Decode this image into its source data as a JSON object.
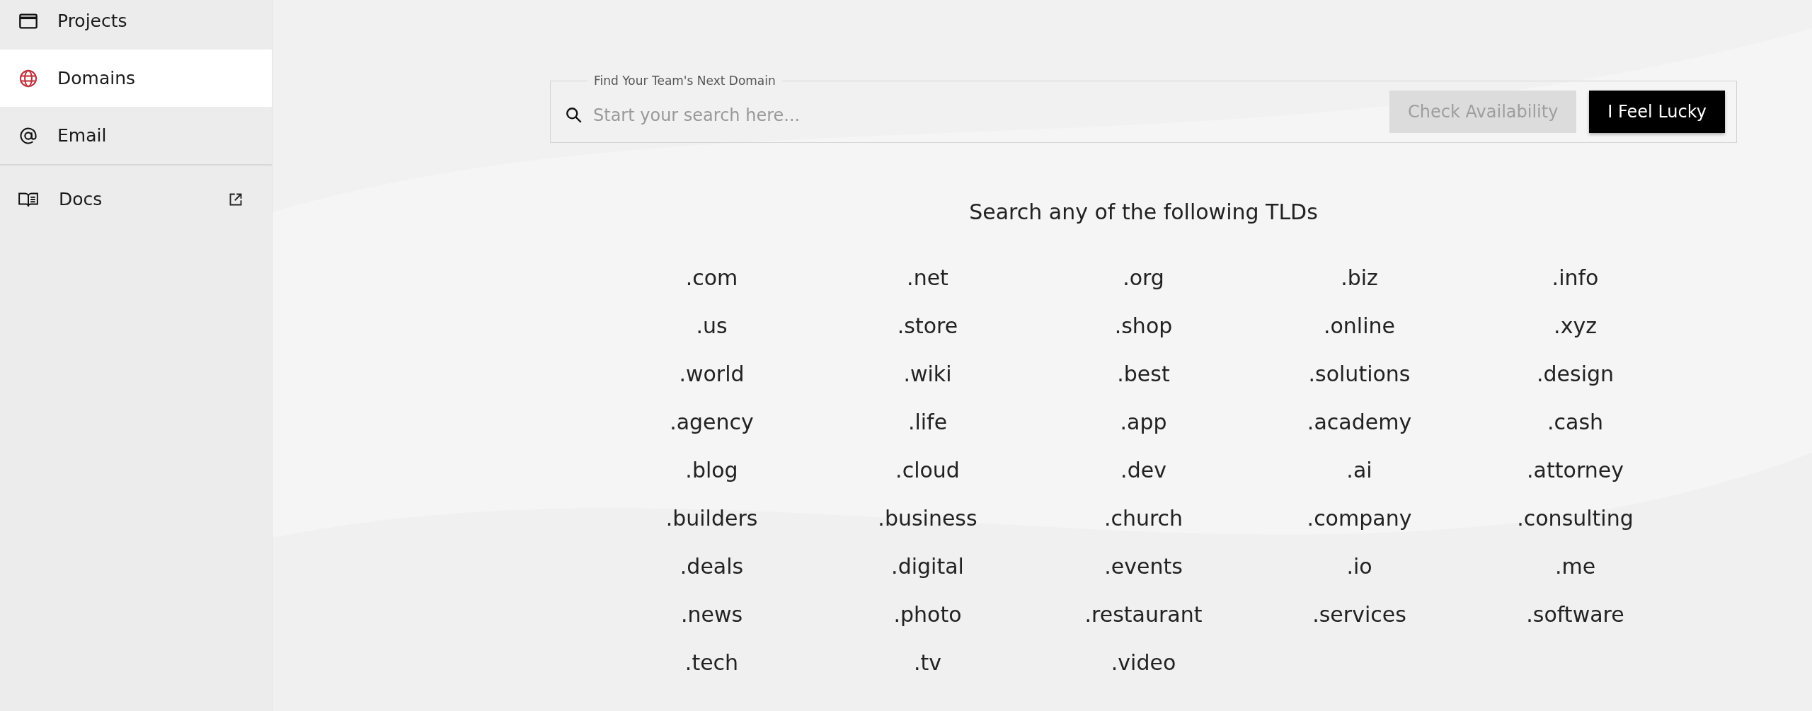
{
  "sidebar": {
    "items": [
      {
        "label": "Projects",
        "kind": "window",
        "selected": false,
        "external": false
      },
      {
        "label": "Domains",
        "kind": "globe",
        "selected": true,
        "external": false
      },
      {
        "label": "Email",
        "kind": "at",
        "selected": false,
        "external": false
      },
      {
        "label": "Docs",
        "kind": "book",
        "selected": false,
        "external": true
      }
    ]
  },
  "search": {
    "legend": "Find Your Team's Next Domain",
    "placeholder": "Start your search here...",
    "buttons": [
      {
        "label": "Check Availability",
        "kind": "secondary",
        "disabled": true
      },
      {
        "label": "I Feel Lucky",
        "kind": "primary",
        "disabled": false
      }
    ]
  },
  "tlds": {
    "heading": "Search any of the following TLDs",
    "items": [
      ".com",
      ".net",
      ".org",
      ".biz",
      ".info",
      ".us",
      ".store",
      ".shop",
      ".online",
      ".xyz",
      ".world",
      ".wiki",
      ".best",
      ".solutions",
      ".design",
      ".agency",
      ".life",
      ".app",
      ".academy",
      ".cash",
      ".blog",
      ".cloud",
      ".dev",
      ".ai",
      ".attorney",
      ".builders",
      ".business",
      ".church",
      ".company",
      ".consulting",
      ".deals",
      ".digital",
      ".events",
      ".io",
      ".me",
      ".news",
      ".photo",
      ".restaurant",
      ".services",
      ".software",
      ".tech",
      ".tv",
      ".video"
    ]
  }
}
